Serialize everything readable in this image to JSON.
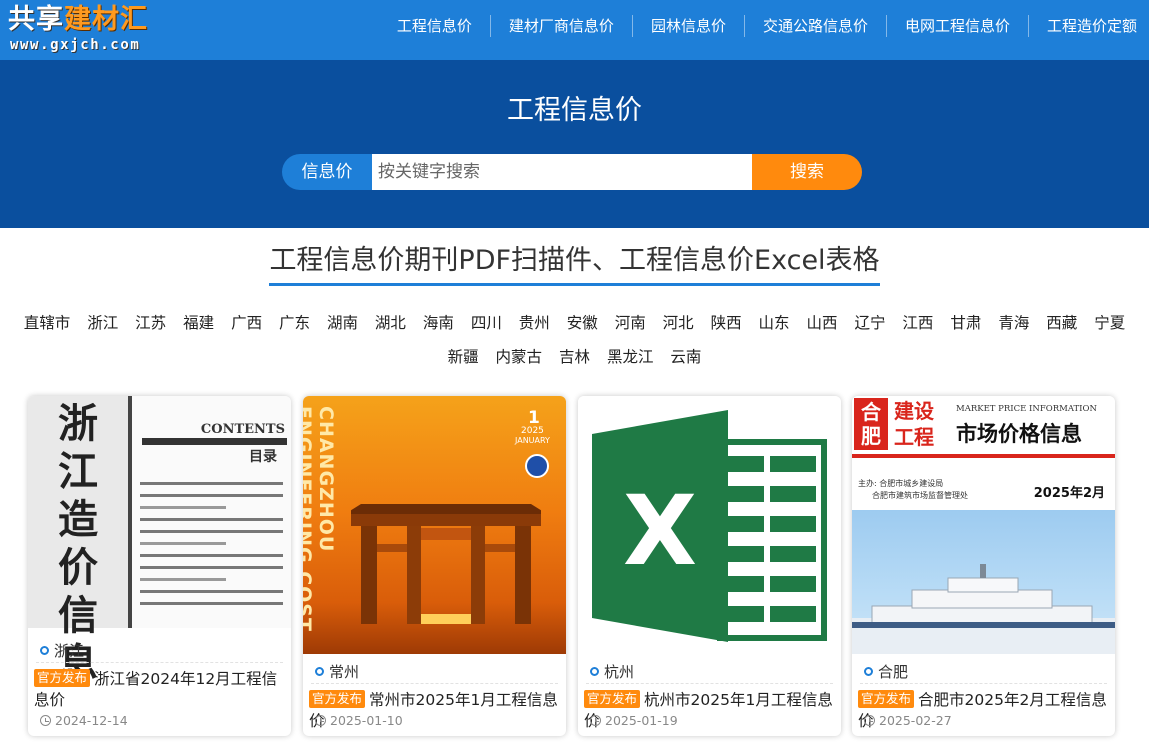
{
  "logo": {
    "line1_a": "共享",
    "line1_b": "建材汇",
    "domain": "www.gxjch.com"
  },
  "nav": [
    {
      "label": "工程信息价"
    },
    {
      "label": "建材厂商信息价"
    },
    {
      "label": "园林信息价"
    },
    {
      "label": "交通公路信息价"
    },
    {
      "label": "电网工程信息价"
    },
    {
      "label": "工程造价定额"
    }
  ],
  "hero": {
    "title": "工程信息价",
    "search_label": "信息价",
    "search_placeholder": "按关键字搜索",
    "search_button": "搜索"
  },
  "section_title": "工程信息价期刊PDF扫描件、工程信息价Excel表格",
  "provinces_row1": [
    "直辖市",
    "浙江",
    "江苏",
    "福建",
    "广西",
    "广东",
    "湖南",
    "湖北",
    "海南",
    "四川",
    "贵州",
    "安徽",
    "河南",
    "河北",
    "陕西",
    "山东",
    "山西",
    "辽宁",
    "江西",
    "甘肃",
    "青海",
    "西藏",
    "宁夏"
  ],
  "provinces_row2": [
    "新疆",
    "内蒙古",
    "吉林",
    "黑龙江",
    "云南"
  ],
  "cards": [
    {
      "location": "浙江",
      "tag": "官方发布",
      "title": "浙江省2024年12月工程信息价",
      "date": "2024-12-14",
      "cover": {
        "vertical_text": "浙江造价信息",
        "contents": "CONTENTS",
        "mulu": "目录"
      }
    },
    {
      "location": "常州",
      "tag": "官方发布",
      "title": "常州市2025年1月工程信息价",
      "date": "2025-01-10",
      "cover": {
        "vertical_text": "CHANGZHOU ENGINEERING COST INFO",
        "issue": "1",
        "year": "2025",
        "month": "JANUARY"
      }
    },
    {
      "location": "杭州",
      "tag": "官方发布",
      "title": "杭州市2025年1月工程信息价",
      "date": "2025-01-19",
      "cover": {
        "letter": "X"
      }
    },
    {
      "location": "合肥",
      "tag": "官方发布",
      "title": "合肥市2025年2月工程信息价",
      "date": "2025-02-27",
      "cover": {
        "badge": "合肥",
        "badge_right": "建设工程",
        "mpi": "MARKET PRICE INFORMATION",
        "heading": "市场价格信息",
        "sponsor1": "主办: 合肥市城乡建设局",
        "sponsor2": "合肥市建筑市场监督管理处",
        "issue_date": "2025年2月"
      }
    }
  ],
  "colors": {
    "nav_blue": "#1e7fd8",
    "hero_blue": "#0a4f9e",
    "orange": "#ff8a0d",
    "excel_green": "#1f7a45"
  }
}
